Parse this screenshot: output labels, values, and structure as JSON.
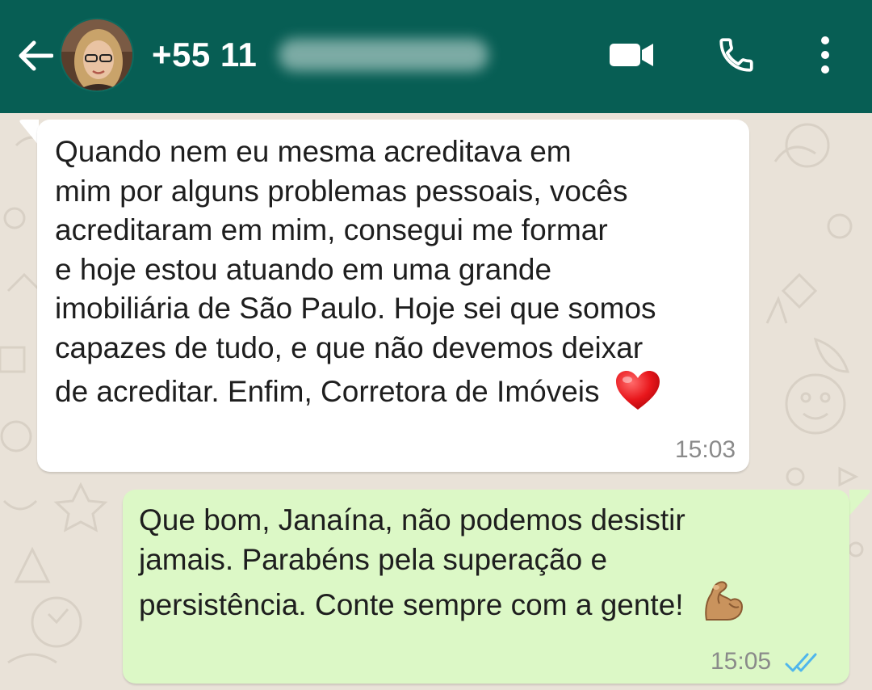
{
  "header": {
    "contact_name": "+55 11",
    "back_icon": "arrow-left-icon",
    "video_icon": "video-camera-icon",
    "call_icon": "phone-icon",
    "menu_icon": "vertical-dots-icon",
    "background_color": "#075e54"
  },
  "messages": [
    {
      "direction": "incoming",
      "lines": [
        "Quando nem eu mesma acreditava em",
        "mim por alguns problemas pessoais, vocês",
        "acreditaram em mim, consegui me formar",
        "e hoje estou atuando em uma grande",
        "imobiliária de São Paulo. Hoje sei que somos",
        "capazes de tudo, e que não devemos deixar",
        "de acreditar. Enfim, Corretora de Imóveis"
      ],
      "emoji": "red-heart-icon",
      "time": "15:03",
      "bubble_color": "#ffffff"
    },
    {
      "direction": "outgoing",
      "lines": [
        "Que bom, Janaína, não podemos desistir",
        "jamais. Parabéns pela superação e",
        "persistência. Conte sempre com a gente!"
      ],
      "emoji": "flexed-biceps-icon",
      "time": "15:05",
      "status_icon": "double-check-read-icon",
      "bubble_color": "#dcf8c6"
    }
  ]
}
